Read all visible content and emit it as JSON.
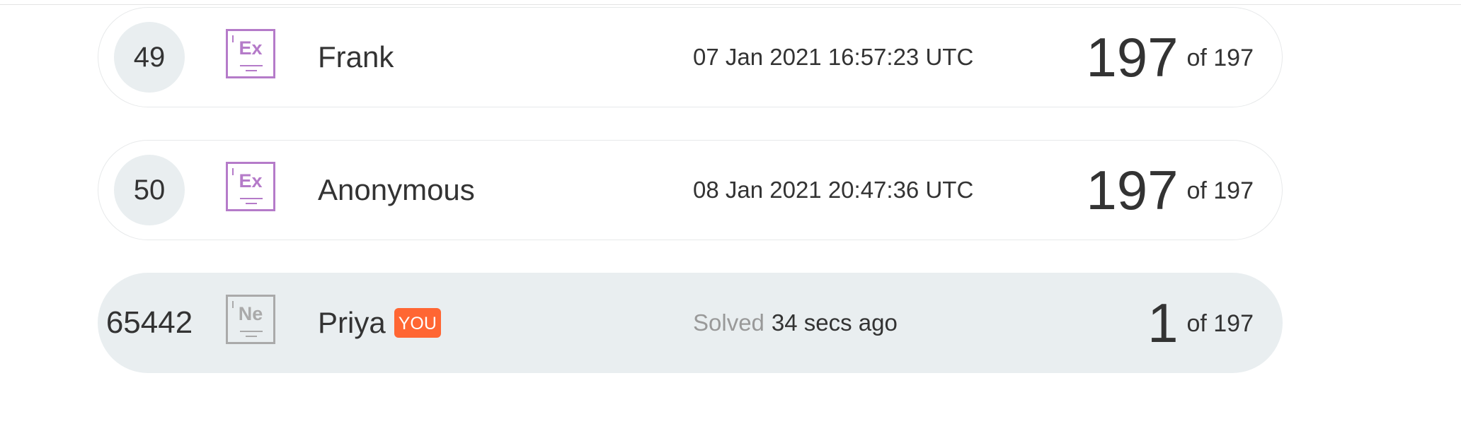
{
  "leaderboard": {
    "rows": [
      {
        "rank": "49",
        "badge_symbol": "Ex",
        "name": "Frank",
        "time": "07 Jan 2021 16:57:23 UTC",
        "solved": "197",
        "total_text": "of 197"
      },
      {
        "rank": "50",
        "badge_symbol": "Ex",
        "name": "Anonymous",
        "time": "08 Jan 2021 20:47:36 UTC",
        "solved": "197",
        "total_text": "of 197"
      }
    ],
    "current_user": {
      "rank": "65442",
      "badge_symbol": "Ne",
      "name": "Priya",
      "you_label": "YOU",
      "status_prefix": "Solved",
      "time": "34 secs ago",
      "solved": "1",
      "total_text": "of 197"
    }
  },
  "colors": {
    "badge_expert": "#b57bc9",
    "badge_newbie": "#aaaaaa",
    "you_tag": "#ff6633",
    "current_row_bg": "#e9eef0"
  },
  "icons": {
    "badge": "level-badge-icon"
  }
}
